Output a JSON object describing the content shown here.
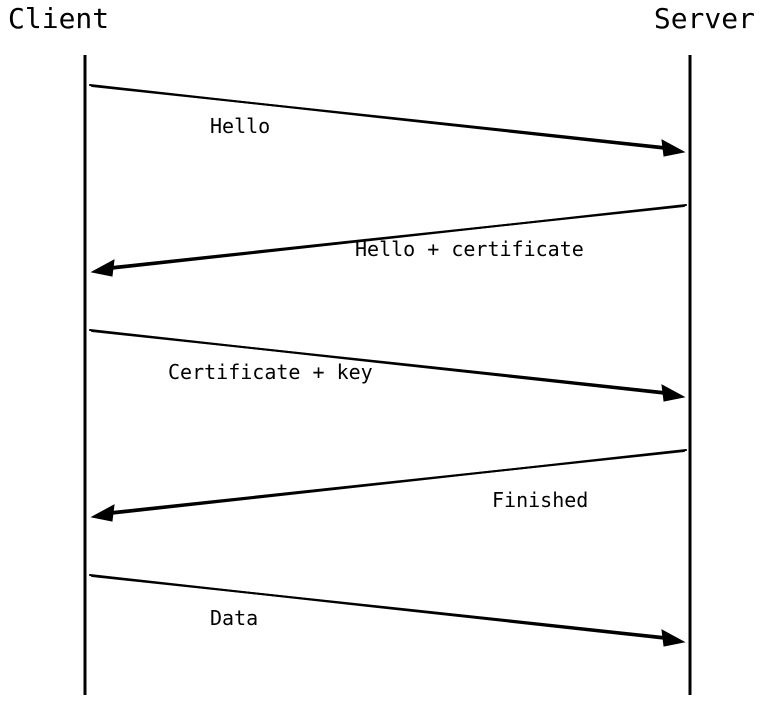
{
  "participants": {
    "left": "Client",
    "right": "Server"
  },
  "messages": [
    {
      "label": "Hello",
      "from": "left",
      "to": "right"
    },
    {
      "label": "Hello + certificate",
      "from": "right",
      "to": "left"
    },
    {
      "label": "Certificate + key",
      "from": "left",
      "to": "right"
    },
    {
      "label": "Finished",
      "from": "right",
      "to": "left"
    },
    {
      "label": "Data",
      "from": "left",
      "to": "right"
    }
  ]
}
